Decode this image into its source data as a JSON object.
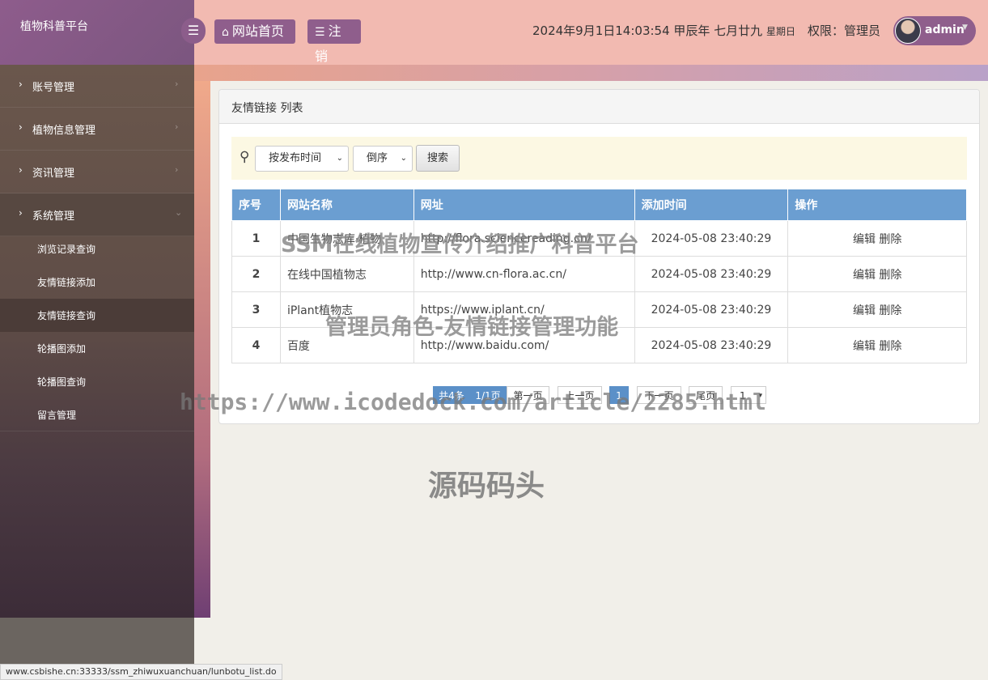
{
  "app": {
    "title": "植物科普平台"
  },
  "header": {
    "home_label": "网站首页",
    "logout_label": "注销",
    "datetime_main": "2024年9月1日14:03:54 甲辰年 七月廿九",
    "weekday": "星期日",
    "role": "权限：管理员",
    "username": "admin"
  },
  "sidebar": {
    "menus": [
      {
        "label": "账号管理"
      },
      {
        "label": "植物信息管理"
      },
      {
        "label": "资讯管理"
      },
      {
        "label": "系统管理"
      }
    ],
    "subitems": [
      {
        "label": "浏览记录查询"
      },
      {
        "label": "友情链接添加"
      },
      {
        "label": "友情链接查询"
      },
      {
        "label": "轮播图添加"
      },
      {
        "label": "轮播图查询"
      },
      {
        "label": "留言管理"
      }
    ]
  },
  "panel": {
    "title": "友情链接 列表"
  },
  "search": {
    "sort_field": "按发布时间",
    "sort_order": "倒序",
    "button": "搜索"
  },
  "table": {
    "headers": [
      "序号",
      "网站名称",
      "网址",
      "添加时间",
      "操作"
    ],
    "rows": [
      {
        "no": "1",
        "name": "中国生物志库·植物",
        "url": "http://flora.sciencereading.cn/",
        "time": "2024-05-08 23:40:29",
        "edit": "编辑",
        "delete": "删除"
      },
      {
        "no": "2",
        "name": "在线中国植物志",
        "url": "http://www.cn-flora.ac.cn/",
        "time": "2024-05-08 23:40:29",
        "edit": "编辑",
        "delete": "删除"
      },
      {
        "no": "3",
        "name": "iPlant植物志",
        "url": "https://www.iplant.cn/",
        "time": "2024-05-08 23:40:29",
        "edit": "编辑",
        "delete": "删除"
      },
      {
        "no": "4",
        "name": "百度",
        "url": "http://www.baidu.com/",
        "time": "2024-05-08 23:40:29",
        "edit": "编辑",
        "delete": "删除"
      }
    ]
  },
  "pager": {
    "total": "共4条",
    "pages": "1/1页",
    "first": "第一页",
    "prev": "上一页",
    "current": "1",
    "next": "下一页",
    "last": "尾页",
    "jump": "1"
  },
  "watermarks": {
    "line1": "SSM在线植物宣传介绍推广科普平台",
    "line2": "管理员角色-友情链接管理功能",
    "line3": "https://www.icodedock.com/article/2285.html",
    "line4": "源码码头"
  },
  "statusbar": {
    "url": "www.csbishe.cn:33333/ssm_zhiwuxuanchuan/lunbotu_list.do"
  }
}
